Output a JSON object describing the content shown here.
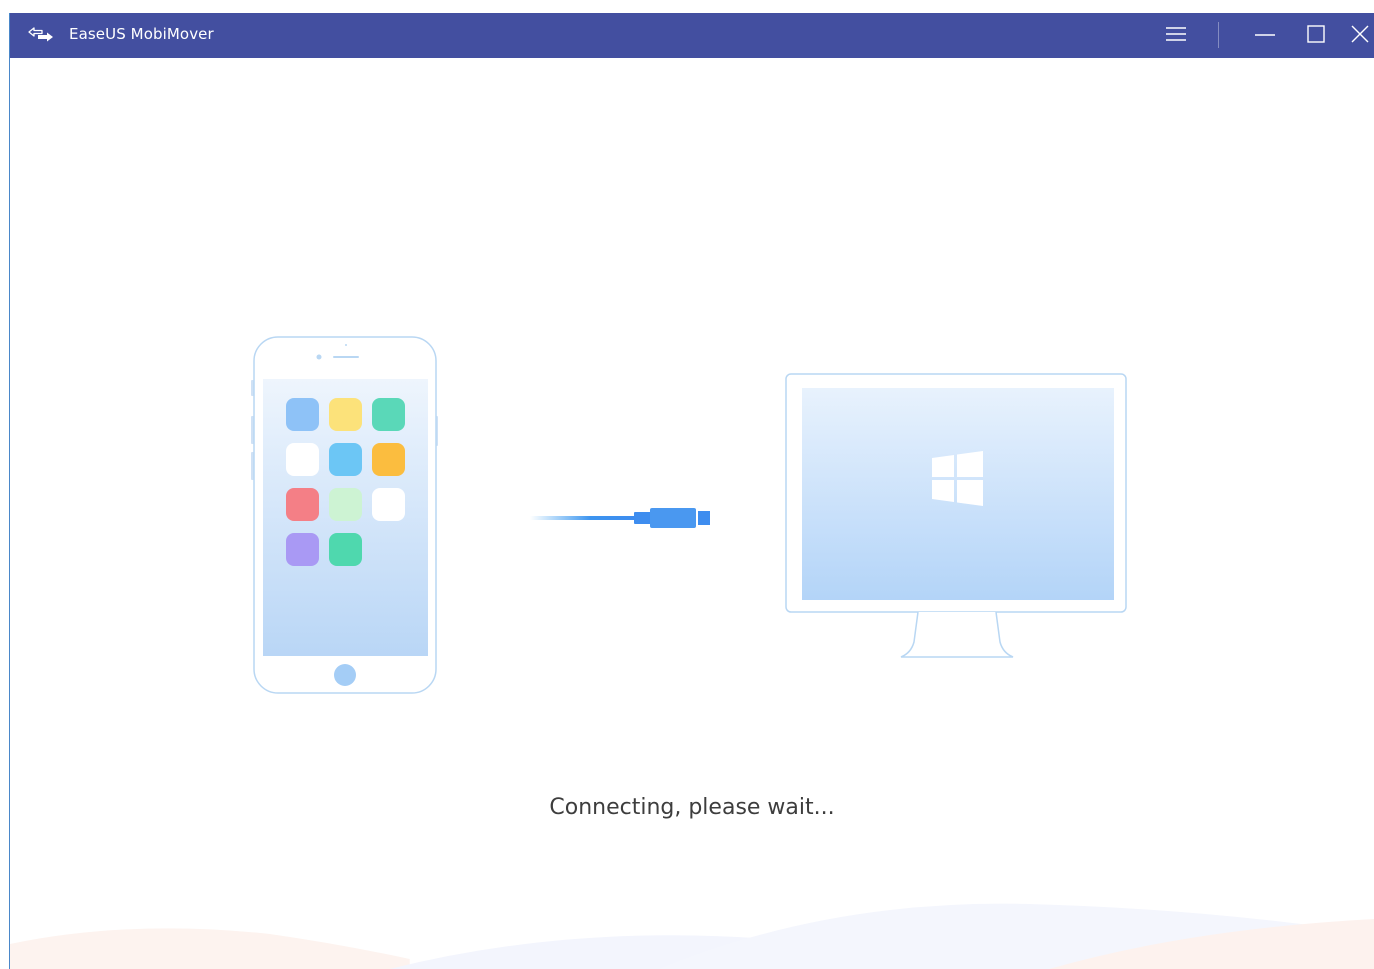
{
  "titlebar": {
    "app_title": "EaseUS MobiMover",
    "logo_icon": "transfer-arrows-icon",
    "menu_icon": "hamburger-menu-icon",
    "minimize_icon": "minimize-icon",
    "maximize_icon": "maximize-icon",
    "close_icon": "close-icon",
    "background_color": "#434fa0"
  },
  "illustration": {
    "phone_icon": "smartphone-icon",
    "cable_icon": "usb-cable-icon",
    "monitor_icon": "windows-monitor-icon",
    "app_tile_colors": [
      "#8ec2f7",
      "#fce27a",
      "#5ad8b8",
      "#ffffff",
      "#6cc6f5",
      "#fbbd3f",
      "#f47f86",
      "#cdf3d3",
      "#ffffff",
      "#a999f4",
      "#4fd8ae"
    ]
  },
  "status": {
    "message": "Connecting, please wait..."
  }
}
